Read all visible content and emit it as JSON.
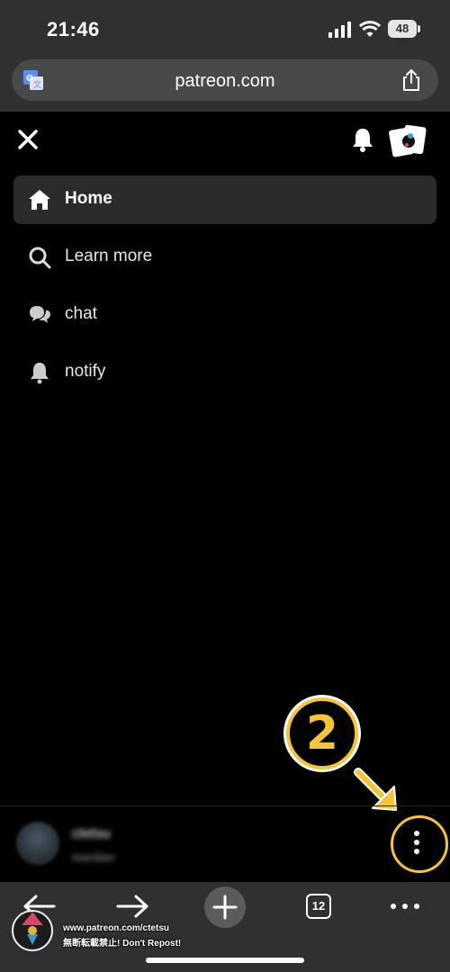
{
  "status_bar": {
    "time": "21:46",
    "battery": "48",
    "icons": [
      "signal-icon",
      "wifi-icon",
      "battery-icon"
    ]
  },
  "browser": {
    "url": "patreon.com",
    "tab_count": "12"
  },
  "menu": {
    "items": [
      {
        "label": "Home",
        "icon": "home-icon",
        "active": true
      },
      {
        "label": "Learn more",
        "icon": "search-icon",
        "active": false
      },
      {
        "label": "chat",
        "icon": "chat-icon",
        "active": false
      },
      {
        "label": "notify",
        "icon": "bell-icon",
        "active": false
      }
    ]
  },
  "user": {
    "name": "ctetsu",
    "subtitle": "member"
  },
  "annotation": {
    "step": "2",
    "color": "#f6c533"
  },
  "watermark": {
    "line1": "www.patreon.com/ctetsu",
    "line2": "無断転載禁止! Don't Repost!"
  },
  "colors": {
    "chrome": "#2f3031",
    "active_item": "#2b2b2c",
    "accent": "#f6c533"
  }
}
